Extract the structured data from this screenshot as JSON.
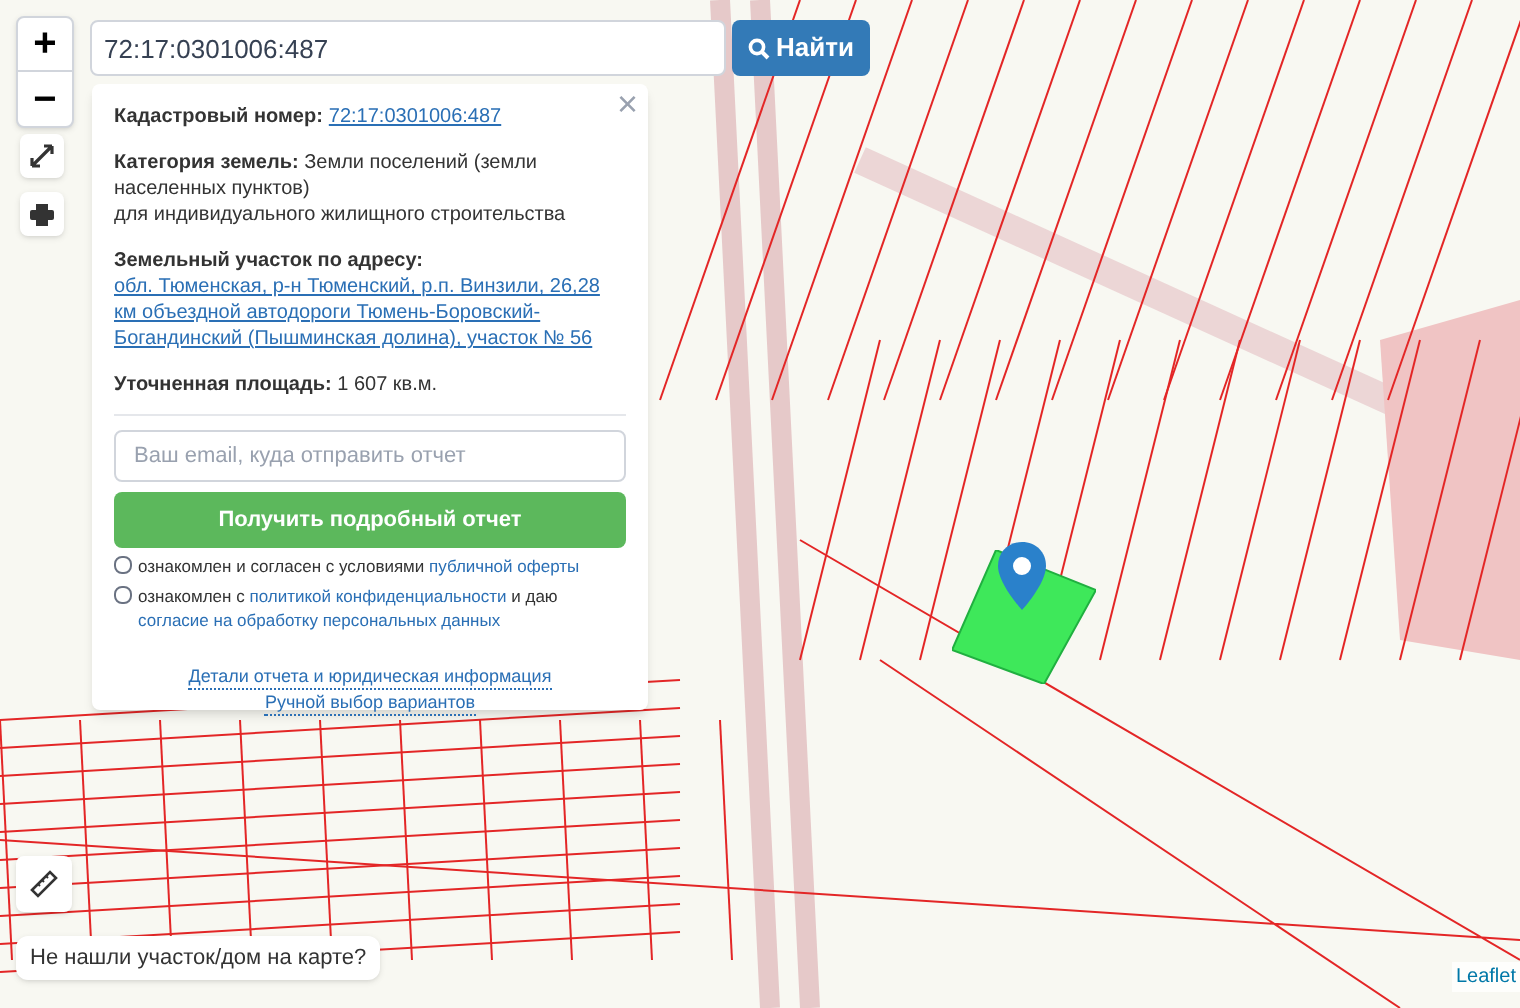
{
  "search": {
    "value": "72:17:0301006:487",
    "button": "Найти"
  },
  "zoom": {
    "in": "+",
    "out": "−"
  },
  "popup": {
    "close": "×",
    "fields": [
      {
        "label": "Кадастровый номер:",
        "value": "72:17:0301006:487",
        "kind": "link"
      },
      {
        "label": "Категория земель:",
        "value": "Земли поселений (земли населенных пунктов)",
        "extra": "для индивидуального жилищного строительства",
        "kind": "text"
      },
      {
        "label": "Земельный участок по адресу:",
        "value": "обл. Тюменская, р-н Тюменский, р.п. Винзили, 26,28 км объездной автодороги Тюмень-Боровский-Богандинский (Пышминская долина), участок № 56",
        "kind": "link_block"
      },
      {
        "label": "Уточненная площадь:",
        "value": "1 607 кв.м.",
        "kind": "text"
      }
    ],
    "email": {
      "placeholder": "Ваш email, куда отправить отчет"
    },
    "submit": "Получить подробный отчет",
    "agreements": [
      {
        "checked": false,
        "parts": [
          {
            "text": "ознакомлен и согласен с условиями",
            "kind": "text"
          },
          {
            "text": "публичной оферты",
            "kind": "link"
          }
        ]
      },
      {
        "checked": false,
        "parts": [
          {
            "text": "ознакомлен с",
            "kind": "text"
          },
          {
            "text": "политикой конфиденциальности",
            "kind": "link"
          },
          {
            "text": "и даю",
            "kind": "text"
          },
          {
            "text": "согласие на обработку персональных данных",
            "kind": "link"
          }
        ]
      }
    ],
    "links": [
      "Детали отчета и юридическая информация",
      "Ручной выбор вариантов"
    ]
  },
  "not_found": "Не нашли участок/дом на карте?",
  "attribution": "Leaflet"
}
